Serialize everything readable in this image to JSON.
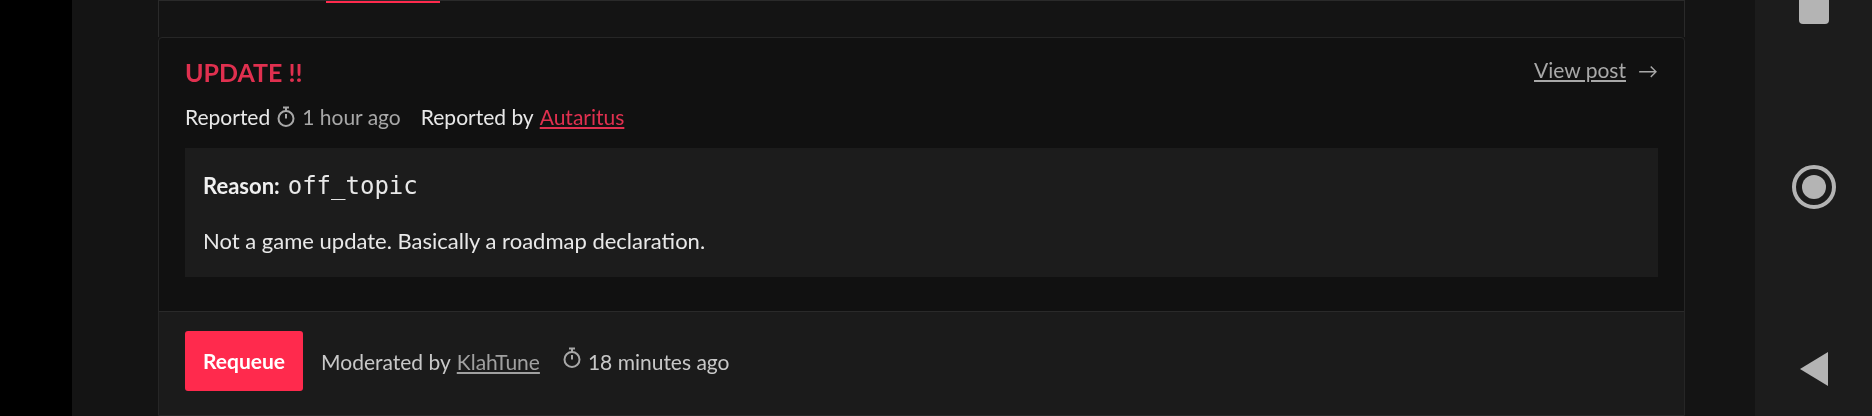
{
  "report": {
    "title": "UPDATE !!",
    "view_post": {
      "label": "View post",
      "arrow": "→"
    },
    "meta": {
      "reported_label": "Reported",
      "reported_time": "1 hour ago",
      "reported_by_label": "Reported by",
      "reporter": "Autaritus"
    },
    "reason": {
      "label": "Reason:",
      "code": "off_topic",
      "text": "Not a game update. Basically a roadmap declaration."
    },
    "footer": {
      "button": "Requeue",
      "moderated_by_label": "Moderated by",
      "moderator": "KlahTune",
      "moderated_time": "18 minutes ago"
    }
  }
}
